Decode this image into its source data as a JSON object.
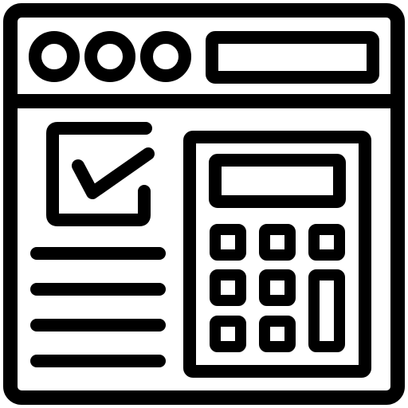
{
  "icon": {
    "name": "browser-calculator-checklist-icon",
    "stroke_color": "#000000",
    "background_color": "#ffffff",
    "parts": {
      "window": "browser-window-frame",
      "title_dots": [
        "window-dot-1",
        "window-dot-2",
        "window-dot-3"
      ],
      "address_bar": "address-bar",
      "checkbox": "checked-checkbox-icon",
      "text_lines_count": 4,
      "calculator": "calculator-icon",
      "calculator_key_rows": 3,
      "calculator_key_cols": 3
    }
  }
}
